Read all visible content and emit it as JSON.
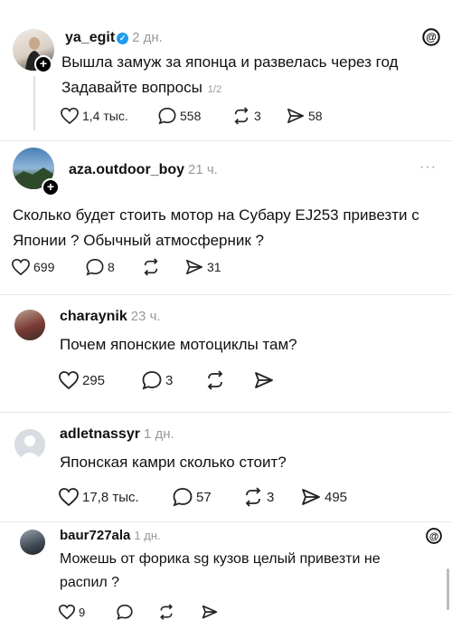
{
  "posts": [
    {
      "username": "ya_egit",
      "time": "2 дн.",
      "text": "Вышла замуж за японца и развелась через год",
      "text2": "Задавайте вопросы",
      "counter": "1/2",
      "likes": "1,4 тыс.",
      "comments": "558",
      "reposts": "3",
      "shares": "58"
    },
    {
      "username": "aza.outdoor_boy",
      "time": "21 ч.",
      "text": "Сколько будет стоить мотор на Субару EJ253 привезти с Японии ? Обычный атмосферник ?",
      "likes": "699",
      "comments": "8",
      "shares": "31"
    },
    {
      "username": "charaynik",
      "time": "23 ч.",
      "text": "Почем японские мотоциклы там?",
      "likes": "295",
      "comments": "3"
    },
    {
      "username": "adletnassyr",
      "time": "1 дн.",
      "text": "Японская камри сколько стоит?",
      "likes": "17,8 тыс.",
      "comments": "57",
      "reposts": "3",
      "shares": "495"
    },
    {
      "username": "baur727ala",
      "time": "1 дн.",
      "text": "Можешь от форика sg кузов целый привезти не распил ?",
      "likes": "9"
    }
  ],
  "icons": {
    "threads": "threads-logo-icon",
    "more": "more-dots-icon",
    "like": "heart-icon",
    "comment": "comment-icon",
    "repost": "repost-icon",
    "share": "send-icon"
  },
  "colors": {
    "verified": "#1d9bf0",
    "muted": "#999999"
  }
}
